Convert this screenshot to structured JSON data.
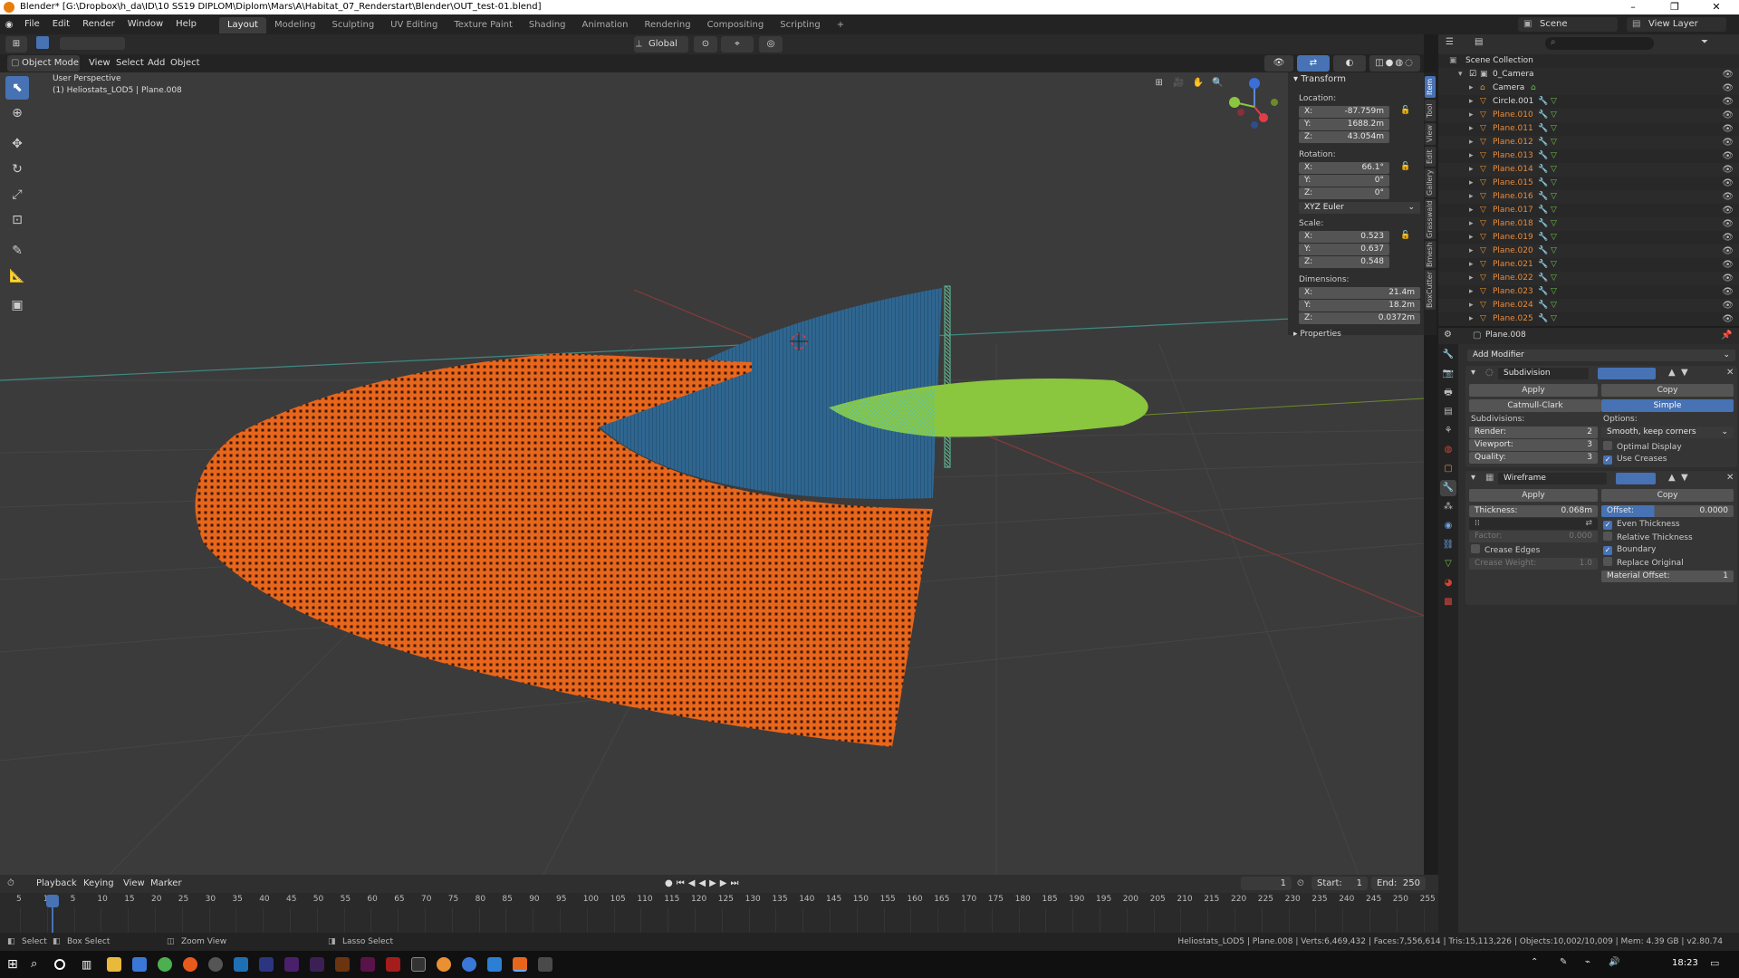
{
  "window": {
    "title": "Blender* [G:\\Dropbox\\h_da\\ID\\10 SS19 DIPLOM\\Diplom\\Mars\\A\\Habitat_07_Renderstart\\Blender\\OUT_test-01.blend]",
    "minimize": "–",
    "maximize": "❐",
    "close": "✕"
  },
  "menu": [
    "File",
    "Edit",
    "Render",
    "Window",
    "Help"
  ],
  "workspaces": [
    "Layout",
    "Modeling",
    "Sculpting",
    "UV Editing",
    "Texture Paint",
    "Shading",
    "Animation",
    "Rendering",
    "Compositing",
    "Scripting",
    "+"
  ],
  "active_workspace": "Layout",
  "scene": {
    "label": "Scene",
    "view_layer": "View Layer"
  },
  "header": {
    "mode": "Object Mode",
    "menus": [
      "View",
      "Select",
      "Add",
      "Object"
    ],
    "orientation": "Global"
  },
  "viewport": {
    "view_name": "User Perspective",
    "object_info": "(1) Heliostats_LOD5 | Plane.008"
  },
  "npanel": {
    "title": "Transform",
    "location_label": "Location:",
    "location": [
      {
        "axis": "X:",
        "value": "-87.759m"
      },
      {
        "axis": "Y:",
        "value": "1688.2m"
      },
      {
        "axis": "Z:",
        "value": "43.054m"
      }
    ],
    "rotation_label": "Rotation:",
    "rotation": [
      {
        "axis": "X:",
        "value": "66.1°"
      },
      {
        "axis": "Y:",
        "value": "0°"
      },
      {
        "axis": "Z:",
        "value": "0°"
      }
    ],
    "rotation_mode": "XYZ Euler",
    "scale_label": "Scale:",
    "scale": [
      {
        "axis": "X:",
        "value": "0.523"
      },
      {
        "axis": "Y:",
        "value": "0.637"
      },
      {
        "axis": "Z:",
        "value": "0.548"
      }
    ],
    "dimensions_label": "Dimensions:",
    "dimensions": [
      {
        "axis": "X:",
        "value": "21.4m"
      },
      {
        "axis": "Y:",
        "value": "18.2m"
      },
      {
        "axis": "Z:",
        "value": "0.0372m"
      }
    ],
    "properties": "Properties",
    "tabs": [
      "Item",
      "Tool",
      "View",
      "Edit",
      "Gallery",
      "Grasswald",
      "Bmesh",
      "BoxCutter"
    ]
  },
  "outliner": {
    "root": "Scene Collection",
    "collection": "0_Camera",
    "items": [
      "Camera",
      "Circle.001",
      "Plane.010",
      "Plane.011",
      "Plane.012",
      "Plane.013",
      "Plane.014",
      "Plane.015",
      "Plane.016",
      "Plane.017",
      "Plane.018",
      "Plane.019",
      "Plane.020",
      "Plane.021",
      "Plane.022",
      "Plane.023",
      "Plane.024",
      "Plane.025"
    ]
  },
  "properties": {
    "object": "Plane.008",
    "add_modifier": "Add Modifier",
    "subdivision": {
      "name": "Subdivision",
      "apply": "Apply",
      "copy": "Copy",
      "mode_a": "Catmull-Clark",
      "mode_b": "Simple",
      "subdivisions_label": "Subdivisions:",
      "render_label": "Render:",
      "render": "2",
      "viewport_label": "Viewport:",
      "viewport": "3",
      "quality_label": "Quality:",
      "quality": "3",
      "options_label": "Options:",
      "uv_smooth": "Smooth, keep corners",
      "optimal_display": "Optimal Display",
      "use_creases": "Use Creases"
    },
    "wireframe": {
      "name": "Wireframe",
      "apply": "Apply",
      "copy": "Copy",
      "thickness_label": "Thickness:",
      "thickness": "0.068m",
      "offset_label": "Offset:",
      "offset": "0.0000",
      "factor_label": "Factor:",
      "factor": "0.000",
      "even_thickness": "Even Thickness",
      "relative_thickness": "Relative Thickness",
      "crease_edges": "Crease Edges",
      "boundary": "Boundary",
      "crease_weight_label": "Crease Weight:",
      "crease_weight": "1.0",
      "replace_original": "Replace Original",
      "material_offset_label": "Material Offset:",
      "material_offset": "1"
    }
  },
  "timeline": {
    "menus": [
      "Playback",
      "Keying",
      "View",
      "Marker"
    ],
    "current_frame": "1",
    "start_label": "Start:",
    "start": "1",
    "end_label": "End:",
    "end": "250",
    "ticks": [
      "5",
      "1",
      "5",
      "10",
      "15",
      "20",
      "25",
      "30",
      "35",
      "40",
      "45",
      "50",
      "55",
      "60",
      "65",
      "70",
      "75",
      "80",
      "85",
      "90",
      "95",
      "100",
      "105",
      "110",
      "115",
      "120",
      "125",
      "130",
      "135",
      "140",
      "145",
      "150",
      "155",
      "160",
      "165",
      "170",
      "175",
      "180",
      "185",
      "190",
      "195",
      "200",
      "205",
      "210",
      "215",
      "220",
      "225",
      "230",
      "235",
      "240",
      "245",
      "250",
      "255"
    ]
  },
  "status": {
    "select": "Select",
    "box_select": "Box Select",
    "zoom_view": "Zoom View",
    "lasso_select": "Lasso Select",
    "stats": "Heliostats_LOD5 | Plane.008 | Verts:6,469,432 | Faces:7,556,614 | Tris:15,113,226 | Objects:10,002/10,009 | Mem: 4.39 GB | v2.80.74"
  },
  "taskbar": {
    "clock": "18:23"
  },
  "colors": {
    "accent": "#4772b3",
    "orange": "#e8661c",
    "blue_mesh": "#2f6690",
    "green_mesh": "#8bc63f"
  }
}
